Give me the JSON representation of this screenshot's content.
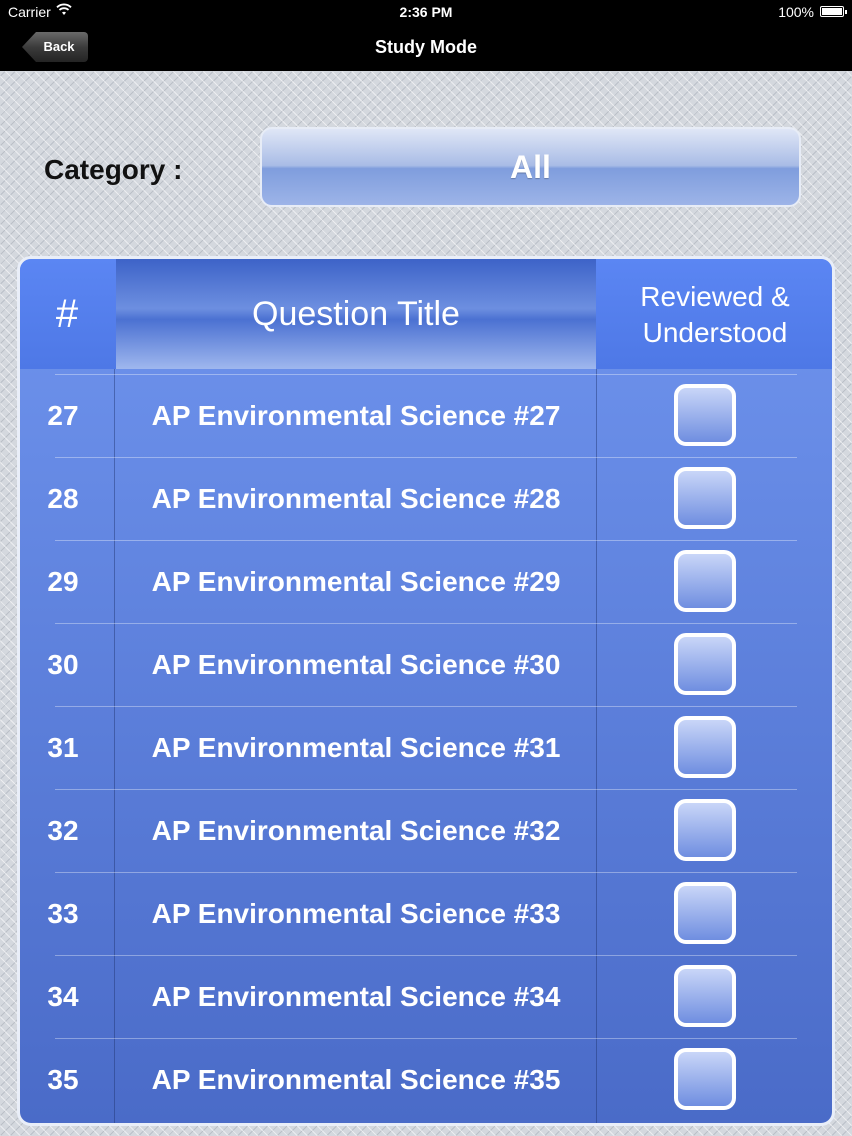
{
  "status_bar": {
    "carrier": "Carrier",
    "time": "2:36 PM",
    "battery": "100%",
    "wifi_icon": "wifi-icon",
    "battery_icon": "battery-icon"
  },
  "navbar": {
    "back_label": "Back",
    "title": "Study Mode"
  },
  "category": {
    "label": "Category :",
    "value": "All"
  },
  "table": {
    "headers": {
      "num": "#",
      "title": "Question Title",
      "reviewed_line1": "Reviewed &",
      "reviewed_line2": "Understood"
    },
    "rows": [
      {
        "num": "27",
        "title": "AP Environmental Science #27",
        "checked": false
      },
      {
        "num": "28",
        "title": "AP Environmental Science #28",
        "checked": false
      },
      {
        "num": "29",
        "title": "AP Environmental Science #29",
        "checked": false
      },
      {
        "num": "30",
        "title": "AP Environmental Science #30",
        "checked": false
      },
      {
        "num": "31",
        "title": "AP Environmental Science #31",
        "checked": false
      },
      {
        "num": "32",
        "title": "AP Environmental Science #32",
        "checked": false
      },
      {
        "num": "33",
        "title": "AP Environmental Science #33",
        "checked": false
      },
      {
        "num": "34",
        "title": "AP Environmental Science #34",
        "checked": false
      },
      {
        "num": "35",
        "title": "AP Environmental Science #35",
        "checked": false
      }
    ]
  },
  "colors": {
    "nav_background": "#000000",
    "table_blue": "#5b86f3",
    "checkbox_border": "#ffffff"
  }
}
